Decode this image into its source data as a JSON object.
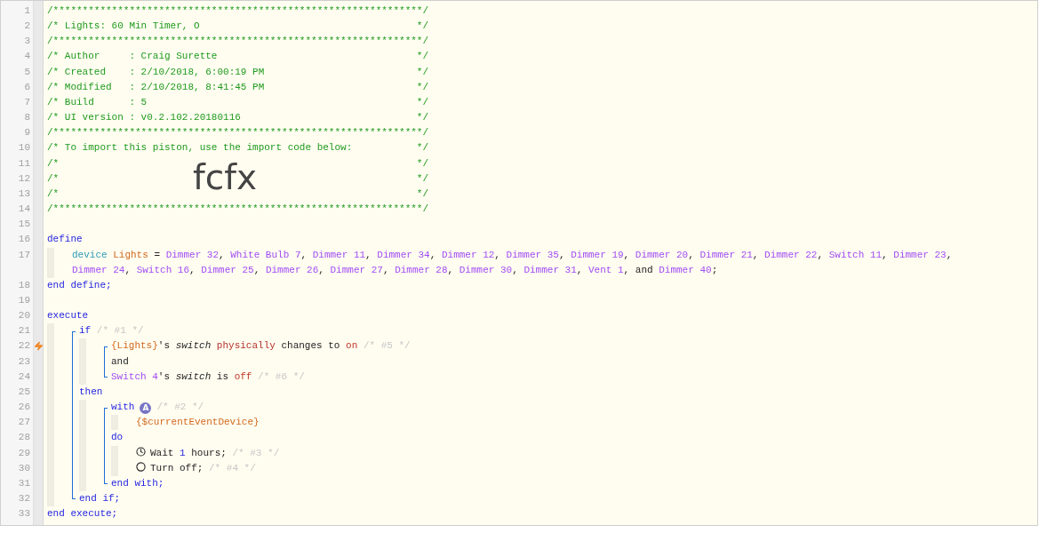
{
  "editor": {
    "lines": [
      {
        "number": "1",
        "kind": "rule",
        "text": "/***************************************************************/"
      },
      {
        "number": "2",
        "kind": "banner",
        "text": "/* Lights: 60 Min Timer, O",
        "end": "*/"
      },
      {
        "number": "3",
        "kind": "rule",
        "text": "/***************************************************************/"
      },
      {
        "number": "4",
        "kind": "banner",
        "text": "/* Author     : Craig Surette",
        "end": "*/"
      },
      {
        "number": "5",
        "kind": "banner",
        "text": "/* Created    : 2/10/2018, 6:00:19 PM",
        "end": "*/"
      },
      {
        "number": "6",
        "kind": "banner",
        "text": "/* Modified   : 2/10/2018, 8:41:45 PM",
        "end": "*/"
      },
      {
        "number": "7",
        "kind": "banner",
        "text": "/* Build      : 5",
        "end": "*/"
      },
      {
        "number": "8",
        "kind": "banner",
        "text": "/* UI version : v0.2.102.20180116",
        "end": "*/"
      },
      {
        "number": "9",
        "kind": "rule",
        "text": "/***************************************************************/"
      },
      {
        "number": "10",
        "kind": "banner",
        "text": "/* To import this piston, use the import code below:",
        "end": "*/"
      },
      {
        "number": "11",
        "kind": "banner",
        "text": "/*",
        "end": "*/"
      },
      {
        "number": "12",
        "kind": "banner",
        "text": "/*",
        "code": "fcfx",
        "end": "*/"
      },
      {
        "number": "13",
        "kind": "banner",
        "text": "/*",
        "end": "*/"
      },
      {
        "number": "14",
        "kind": "rule",
        "text": "/***************************************************************/"
      },
      {
        "number": "15",
        "kind": "blank"
      },
      {
        "number": "16",
        "kind": "code",
        "tokens": [
          {
            "kind": "keyword",
            "text": "define"
          }
        ],
        "children": [
          {
            "number": "17",
            "kind": "code",
            "tokens": [
              {
                "kind": "declare",
                "text": "device "
              },
              {
                "kind": "variable",
                "text": "Lights"
              },
              {
                "kind": "plain",
                "text": " = "
              },
              {
                "kind": "device",
                "text": "Dimmer 32"
              },
              {
                "kind": "plain",
                "text": ", "
              },
              {
                "kind": "device",
                "text": "White Bulb 7"
              },
              {
                "kind": "plain",
                "text": ", "
              },
              {
                "kind": "device",
                "text": "Dimmer 11"
              },
              {
                "kind": "plain",
                "text": ", "
              },
              {
                "kind": "device",
                "text": "Dimmer 34"
              },
              {
                "kind": "plain",
                "text": ", "
              },
              {
                "kind": "device",
                "text": "Dimmer 12"
              },
              {
                "kind": "plain",
                "text": ", "
              },
              {
                "kind": "device",
                "text": "Dimmer 35"
              },
              {
                "kind": "plain",
                "text": ", "
              },
              {
                "kind": "device",
                "text": "Dimmer 19"
              },
              {
                "kind": "plain",
                "text": ", "
              },
              {
                "kind": "device",
                "text": "Dimmer 20"
              },
              {
                "kind": "plain",
                "text": ", "
              },
              {
                "kind": "device",
                "text": "Dimmer 21"
              },
              {
                "kind": "plain",
                "text": ", "
              },
              {
                "kind": "device",
                "text": "Dimmer 22"
              },
              {
                "kind": "plain",
                "text": ", "
              },
              {
                "kind": "device",
                "text": "Switch 11"
              },
              {
                "kind": "plain",
                "text": ", "
              },
              {
                "kind": "device",
                "text": "Dimmer 23"
              },
              {
                "kind": "plain",
                "text": ", "
              },
              {
                "kind": "device",
                "text": "Dimmer 24"
              },
              {
                "kind": "plain",
                "text": ", "
              },
              {
                "kind": "device",
                "text": "Switch 16"
              },
              {
                "kind": "plain",
                "text": ", "
              },
              {
                "kind": "device",
                "text": "Dimmer 25"
              },
              {
                "kind": "plain",
                "text": ", "
              },
              {
                "kind": "device",
                "text": "Dimmer 26"
              },
              {
                "kind": "plain",
                "text": ", "
              },
              {
                "kind": "device",
                "text": "Dimmer 27"
              },
              {
                "kind": "plain",
                "text": ", "
              },
              {
                "kind": "device",
                "text": "Dimmer 28"
              },
              {
                "kind": "plain",
                "text": ", "
              },
              {
                "kind": "device",
                "text": "Dimmer 30"
              },
              {
                "kind": "plain",
                "text": ", "
              },
              {
                "kind": "device",
                "text": "Dimmer 31"
              },
              {
                "kind": "plain",
                "text": ", "
              },
              {
                "kind": "device",
                "text": "Vent 1"
              },
              {
                "kind": "plain",
                "text": ", and "
              },
              {
                "kind": "device",
                "text": "Dimmer 40"
              },
              {
                "kind": "plain",
                "text": ";"
              }
            ]
          }
        ]
      },
      {
        "number": "18",
        "kind": "code",
        "tokens": [
          {
            "kind": "keyword",
            "text": "end define;"
          }
        ]
      },
      {
        "number": "19",
        "kind": "blank"
      },
      {
        "number": "20",
        "kind": "code",
        "tokens": [
          {
            "kind": "keyword",
            "text": "execute"
          }
        ],
        "children": [
          {
            "kind": "group",
            "children": [
              {
                "number": "21",
                "kind": "code",
                "tokens": [
                  {
                    "kind": "keyword",
                    "text": "if"
                  },
                  {
                    "kind": "comment",
                    "text": " /* #1 */"
                  }
                ],
                "children": [
                  {
                    "kind": "group",
                    "children": [
                      {
                        "number": "22",
                        "kind": "code",
                        "trigger": true,
                        "tokens": [
                          {
                            "kind": "variable",
                            "text": "{Lights}"
                          },
                          {
                            "kind": "plain",
                            "text": "'s "
                          },
                          {
                            "kind": "attribute",
                            "text": "switch "
                          },
                          {
                            "kind": "operator",
                            "text": "physically"
                          },
                          {
                            "kind": "plain",
                            "text": " changes to "
                          },
                          {
                            "kind": "value",
                            "text": "on"
                          },
                          {
                            "kind": "comment",
                            "text": " /* #5 */"
                          }
                        ]
                      },
                      {
                        "number": "23",
                        "kind": "code",
                        "tokens": [
                          {
                            "kind": "plain",
                            "text": "and"
                          }
                        ]
                      },
                      {
                        "number": "24",
                        "kind": "code",
                        "tokens": [
                          {
                            "kind": "device",
                            "text": "Switch 4"
                          },
                          {
                            "kind": "plain",
                            "text": "'s "
                          },
                          {
                            "kind": "attribute",
                            "text": "switch "
                          },
                          {
                            "kind": "plain",
                            "text": "is "
                          },
                          {
                            "kind": "value",
                            "text": "off"
                          },
                          {
                            "kind": "comment",
                            "text": " /* #6 */"
                          }
                        ]
                      }
                    ]
                  }
                ]
              },
              {
                "number": "25",
                "kind": "code",
                "tokens": [
                  {
                    "kind": "keyword",
                    "text": "then"
                  }
                ],
                "children": [
                  {
                    "kind": "group",
                    "children": [
                      {
                        "number": "26",
                        "kind": "code",
                        "tokens": [
                          {
                            "kind": "keyword",
                            "text": "with"
                          },
                          {
                            "kind": "badge",
                            "text": "A"
                          },
                          {
                            "kind": "comment",
                            "text": "/* #2 */"
                          }
                        ],
                        "children": [
                          {
                            "number": "27",
                            "kind": "code",
                            "tokens": [
                              {
                                "kind": "variable",
                                "text": "{$currentEventDevice}"
                              }
                            ]
                          }
                        ]
                      },
                      {
                        "number": "28",
                        "kind": "code",
                        "tokens": [
                          {
                            "kind": "keyword",
                            "text": "do"
                          }
                        ],
                        "children": [
                          {
                            "number": "29",
                            "kind": "code",
                            "tokens": [
                              {
                                "kind": "icon-wait"
                              },
                              {
                                "kind": "plain",
                                "text": "Wait "
                              },
                              {
                                "kind": "number",
                                "text": "1"
                              },
                              {
                                "kind": "plain",
                                "text": " hours; "
                              },
                              {
                                "kind": "comment",
                                "text": "/* #3 */"
                              }
                            ]
                          },
                          {
                            "number": "30",
                            "kind": "code",
                            "tokens": [
                              {
                                "kind": "icon-action"
                              },
                              {
                                "kind": "plain",
                                "text": "Turn off; "
                              },
                              {
                                "kind": "comment",
                                "text": "/* #4 */"
                              }
                            ]
                          }
                        ]
                      },
                      {
                        "number": "31",
                        "kind": "code",
                        "tokens": [
                          {
                            "kind": "keyword",
                            "text": "end with;"
                          }
                        ]
                      }
                    ]
                  }
                ]
              },
              {
                "number": "32",
                "kind": "code",
                "tokens": [
                  {
                    "kind": "keyword",
                    "text": "end if;"
                  }
                ]
              }
            ]
          }
        ]
      },
      {
        "number": "33",
        "kind": "code",
        "tokens": [
          {
            "kind": "keyword",
            "text": "end execute;"
          }
        ]
      }
    ]
  }
}
